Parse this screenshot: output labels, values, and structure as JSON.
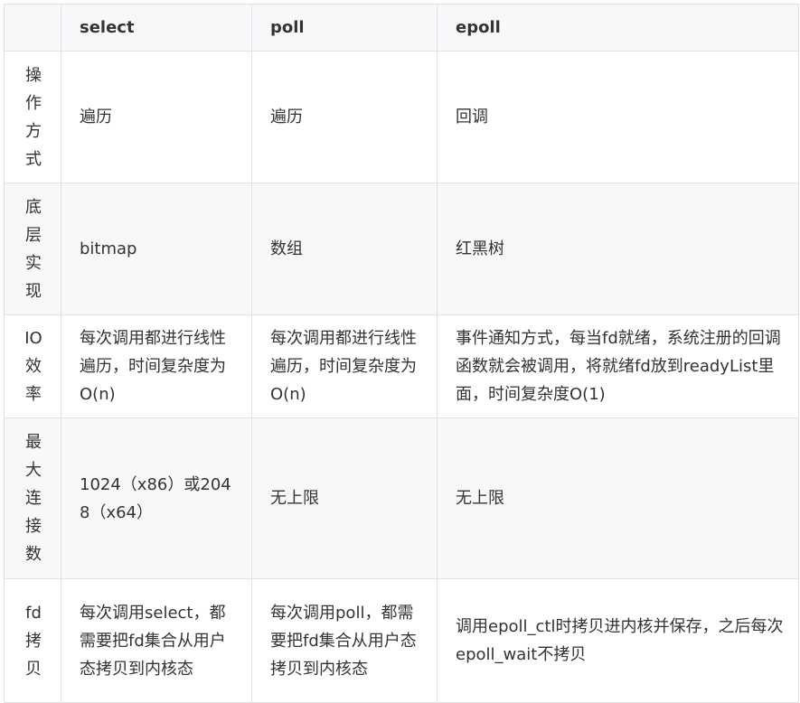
{
  "table": {
    "headers": [
      "",
      "select",
      "poll",
      "epoll"
    ],
    "rows": [
      {
        "label": "操作方式",
        "select": "遍历",
        "poll": "遍历",
        "epoll": "回调"
      },
      {
        "label": "底层实现",
        "select": "bitmap",
        "poll": "数组",
        "epoll": "红黑树"
      },
      {
        "label": "IO效率",
        "select": "每次调用都进行线性遍历，时间复杂度为O(n)",
        "poll": "每次调用都进行线性遍历，时间复杂度为O(n)",
        "epoll": "事件通知方式，每当fd就绪，系统注册的回调函数就会被调用，将就绪fd放到readyList里面，时间复杂度O(1)"
      },
      {
        "label": "最大连接数",
        "select": "1024（x86）或2048（x64）",
        "poll": "无上限",
        "epoll": "无上限"
      },
      {
        "label": "fd拷贝",
        "select": "每次调用select，都需要把fd集合从用户态拷贝到内核态",
        "poll": "每次调用poll，都需要把fd集合从用户态拷贝到内核态",
        "epoll": "调用epoll_ctl时拷贝进内核并保存，之后每次epoll_wait不拷贝"
      }
    ]
  }
}
